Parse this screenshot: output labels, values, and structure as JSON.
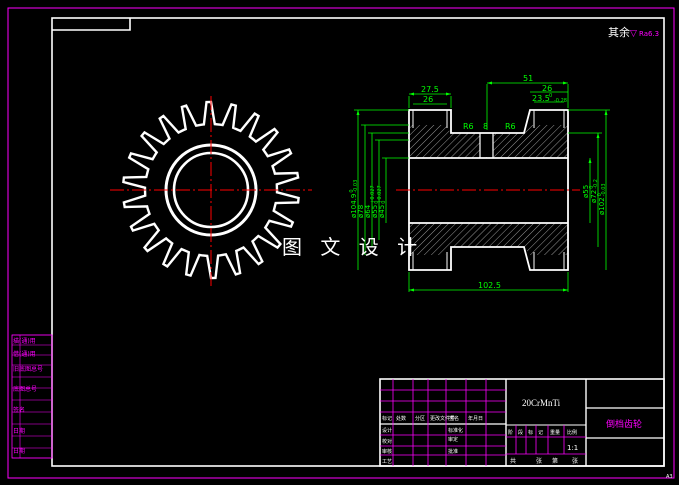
{
  "drawing": {
    "surface_note": "其余",
    "surface_roughness": "Ra6.3",
    "material": "20CrMnTi",
    "part_name": "倒档齿轮",
    "scale": "1:1",
    "watermark": "图 文 设 计",
    "corner_mark": "A3"
  },
  "dimensions": {
    "top_left_outer": "27.5",
    "top_left_inner": "26",
    "top_right_outer": "51",
    "top_right_mid": "26",
    "top_right_tol": "23.5",
    "top_right_tol_sup": "0",
    "top_right_tol_sub": "-0.28",
    "chamfer_left": "R6",
    "groove": "8",
    "chamfer_right": "R6",
    "length_bottom": "102.5",
    "dia_left": [
      "ø104.9",
      "ø78",
      "ø64",
      "ø55",
      "ø45"
    ],
    "dia_left_tol": [
      "0",
      "",
      "",
      "+0.027",
      "+0.027"
    ],
    "dia_left_tol_sub": [
      "-0.03",
      "",
      "",
      "0",
      "0"
    ],
    "dia_right": [
      "ø55",
      "ø72",
      "ø102"
    ],
    "dia_right_tol": [
      "",
      "0",
      "0"
    ],
    "dia_right_tol_sub": [
      "",
      "-0.2",
      "-0.03"
    ]
  },
  "title_block": {
    "head_row": [
      "标记",
      "处数",
      "分区",
      "更改文件号",
      "签名",
      "年月日"
    ],
    "rows_left": [
      "设计",
      "校对",
      "审核",
      "工艺"
    ],
    "rows_mid": [
      "标准化",
      "审定",
      "批准"
    ],
    "stage_headers": [
      "阶",
      "段",
      "标",
      "记",
      "重量",
      "比例"
    ],
    "sheet_labels": [
      "共",
      "张",
      "第",
      "张"
    ]
  },
  "side_table": [
    "描(通)用",
    "借(通)用",
    "旧底图总号",
    "底图总号",
    "签名",
    "日期",
    "日期"
  ],
  "colors": {
    "background": "#000000",
    "frame": "#ffffff",
    "magenta": "#ff00ff",
    "green": "#00ff00",
    "red": "#ff0000"
  }
}
